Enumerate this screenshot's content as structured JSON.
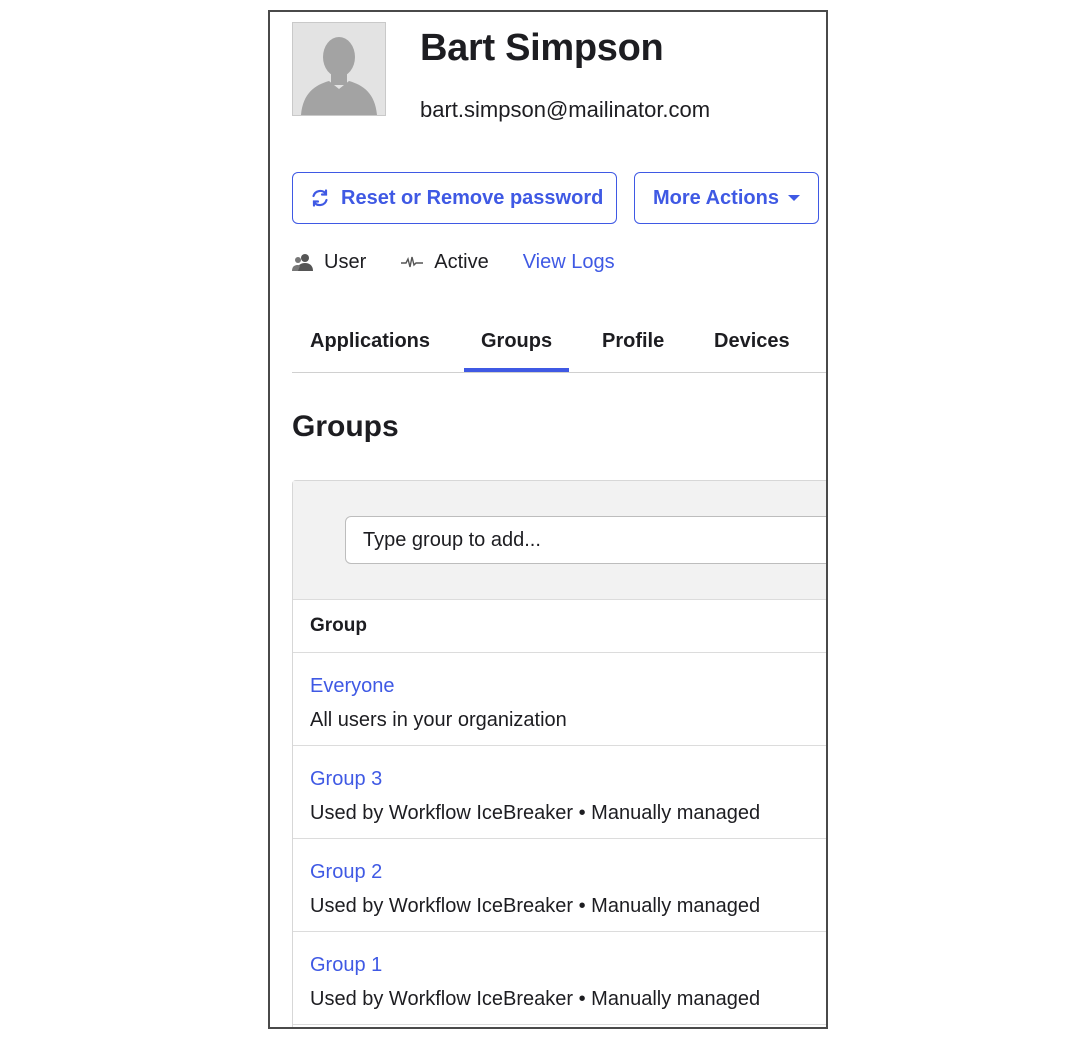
{
  "user": {
    "name": "Bart Simpson",
    "email": "bart.simpson@mailinator.com"
  },
  "actions": {
    "reset_label": "Reset or Remove password",
    "more_label": "More Actions"
  },
  "meta": {
    "role": "User",
    "status": "Active",
    "logs_link": "View Logs"
  },
  "tabs": [
    {
      "label": "Applications",
      "active": false
    },
    {
      "label": "Groups",
      "active": true
    },
    {
      "label": "Profile",
      "active": false
    },
    {
      "label": "Devices",
      "active": false
    }
  ],
  "groups_section": {
    "title": "Groups",
    "search_placeholder": "Type group to add...",
    "column_header": "Group",
    "rows": [
      {
        "name": "Everyone",
        "description": "All users in your organization"
      },
      {
        "name": "Group 3",
        "description": "Used by Workflow IceBreaker • Manually managed"
      },
      {
        "name": "Group 2",
        "description": "Used by Workflow IceBreaker • Manually managed"
      },
      {
        "name": "Group 1",
        "description": "Used by Workflow IceBreaker • Manually managed"
      }
    ]
  },
  "colors": {
    "accent": "#3f59e4",
    "text": "#1d1d21",
    "panel_header_bg": "#f2f2f2"
  },
  "icons": {
    "avatar": "default-avatar-icon",
    "reset": "refresh-icon",
    "more": "caret-down-icon",
    "role": "user-icon",
    "status": "activity-icon"
  }
}
